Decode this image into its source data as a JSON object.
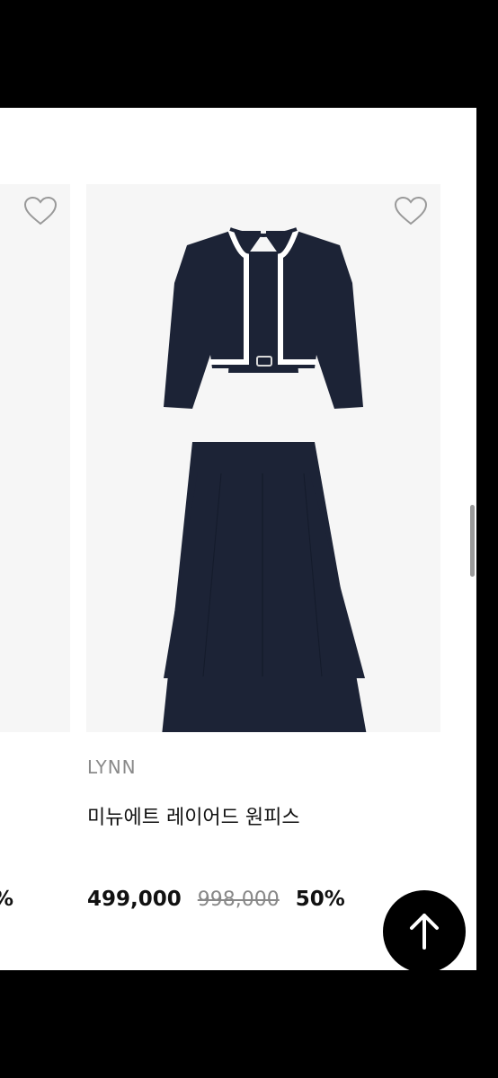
{
  "products": [
    {
      "brand": "",
      "discount": "%",
      "wishlist_icon": "heart-outline-icon"
    },
    {
      "brand": "LYNN",
      "title": "미뉴에트 레이어드 원피스",
      "price": "499,000",
      "original_price": "998,000",
      "discount": "50%",
      "image": "navy-dress-with-white-trim-jacket",
      "wishlist_icon": "heart-outline-icon"
    }
  ],
  "scroll_top_button": {
    "icon": "arrow-up-icon"
  },
  "colors": {
    "dress": "#1c2336",
    "trim": "#ffffff",
    "background": "#f6f6f6"
  }
}
